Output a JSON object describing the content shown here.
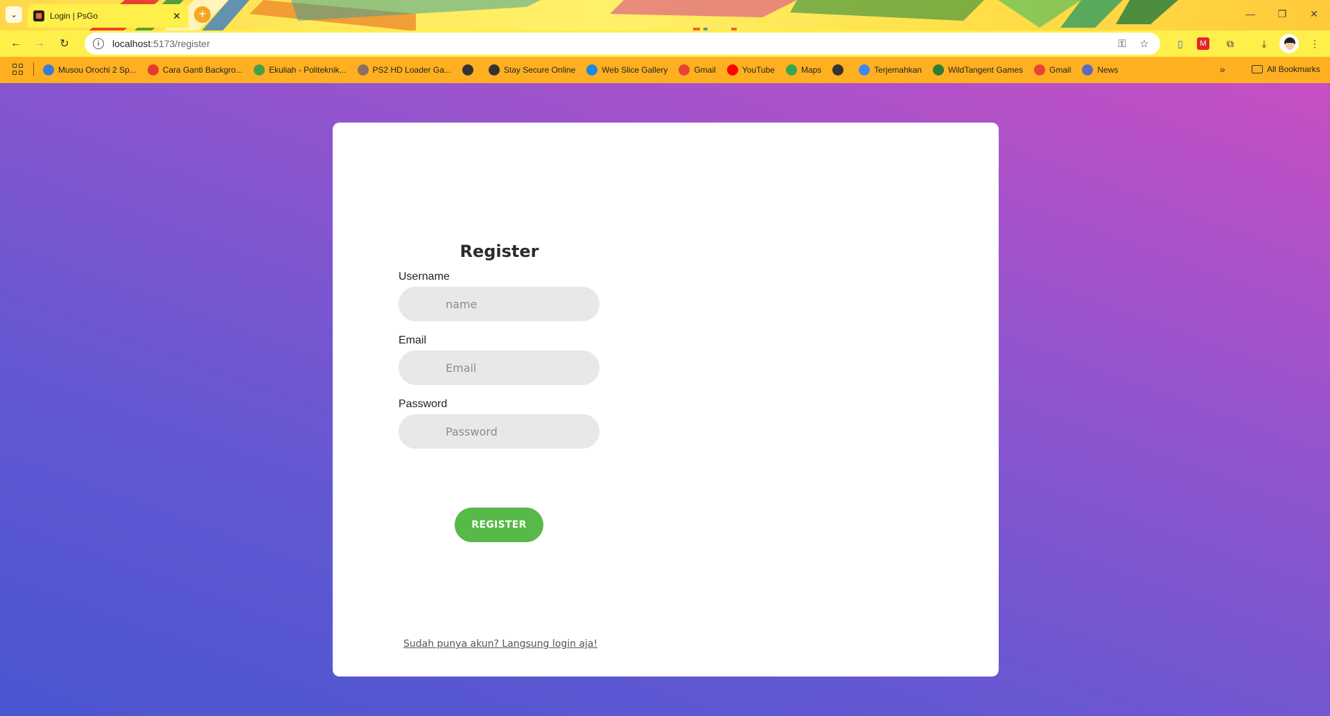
{
  "browser": {
    "tab": {
      "title": "Login | PsGo",
      "close": "✕"
    },
    "new_tab": "+",
    "window_controls": {
      "minimize": "—",
      "restore": "❐",
      "close": "✕"
    },
    "address": {
      "host": "localhost",
      "path": ":5173/register"
    },
    "bookmarks": [
      {
        "label": "Musou Orochi 2 Sp...",
        "color": "#3a7bd5"
      },
      {
        "label": "Cara Ganti Backgro...",
        "color": "#e53935"
      },
      {
        "label": "Ekuliah - Politeknik...",
        "color": "#43a047"
      },
      {
        "label": "PS2 HD Loader Ga...",
        "color": "#8d6e63"
      },
      {
        "label": "",
        "color": "#333333"
      },
      {
        "label": "Stay Secure Online",
        "color": "#333333"
      },
      {
        "label": "Web Slice Gallery",
        "color": "#1e88e5"
      },
      {
        "label": "Gmail",
        "color": "#ea4335"
      },
      {
        "label": "YouTube",
        "color": "#ff0000"
      },
      {
        "label": "Maps",
        "color": "#34a853"
      },
      {
        "label": "",
        "color": "#333333"
      },
      {
        "label": "Terjemahkan",
        "color": "#4285f4"
      },
      {
        "label": "WildTangent Games",
        "color": "#2e7d32"
      },
      {
        "label": "Gmail",
        "color": "#ea4335"
      },
      {
        "label": "News",
        "color": "#5c6bc0"
      }
    ],
    "bookmarks_more": "»",
    "all_bookmarks": "All Bookmarks"
  },
  "form": {
    "title": "Register",
    "username": {
      "label": "Username",
      "placeholder": "name"
    },
    "email": {
      "label": "Email",
      "placeholder": "Email"
    },
    "password": {
      "label": "Password",
      "placeholder": "Password"
    },
    "submit": "REGISTER",
    "login_link": "Sudah punya akun? Langsung login aja!"
  },
  "colors": {
    "accent_button": "#57b947",
    "background_gradient": [
      "#c84fc4",
      "#4a55d0"
    ]
  }
}
